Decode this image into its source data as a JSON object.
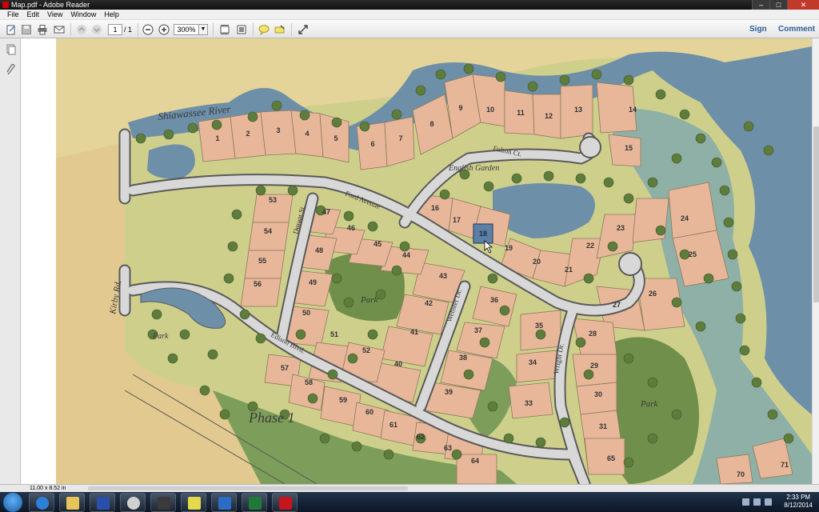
{
  "window": {
    "title": "Map.pdf - Adobe Reader"
  },
  "menu": [
    "File",
    "Edit",
    "View",
    "Window",
    "Help"
  ],
  "toolbar": {
    "page_current": "1",
    "page_total": "/ 1",
    "zoom": "300%",
    "sign_label": "Sign",
    "comment_label": "Comment"
  },
  "status": {
    "page_size": "11.00 x 8.52 in"
  },
  "clock": {
    "time": "2:33 PM",
    "date": "8/12/2014"
  },
  "taskbar_apps": [
    "internet-explorer",
    "file-explorer",
    "fis-app",
    "paint",
    "camera",
    "notes",
    "outlook",
    "excel",
    "adobe-reader"
  ],
  "map": {
    "river_label": "Shiawassee River",
    "roads": [
      "Fulton Ct.",
      "Ford Avenue",
      "Durant St.",
      "Edison Blvd.",
      "Webster Dr.",
      "Wright Dr.",
      "Kirby Rd."
    ],
    "garden_label": "English Garden",
    "park_label": "Park",
    "phase_label": "Phase 1",
    "lots": [
      "1",
      "2",
      "3",
      "4",
      "5",
      "6",
      "7",
      "8",
      "9",
      "10",
      "11",
      "12",
      "13",
      "14",
      "15",
      "16",
      "17",
      "18",
      "19",
      "20",
      "21",
      "22",
      "23",
      "24",
      "25",
      "26",
      "27",
      "28",
      "29",
      "30",
      "31",
      "33",
      "34",
      "35",
      "36",
      "37",
      "38",
      "39",
      "40",
      "41",
      "42",
      "43",
      "44",
      "45",
      "46",
      "47",
      "48",
      "49",
      "50",
      "51",
      "52",
      "53",
      "54",
      "55",
      "56",
      "57",
      "58",
      "59",
      "60",
      "61",
      "62",
      "63",
      "64",
      "65",
      "70",
      "71"
    ],
    "highlighted_lot": "18"
  },
  "colors": {
    "lot": "#e8b79a",
    "water": "#6d8fa8",
    "grass": "#c9c98a",
    "park": "#7d9e5a",
    "road": "#d8d8d8",
    "highlight": "#5c7fa6"
  }
}
